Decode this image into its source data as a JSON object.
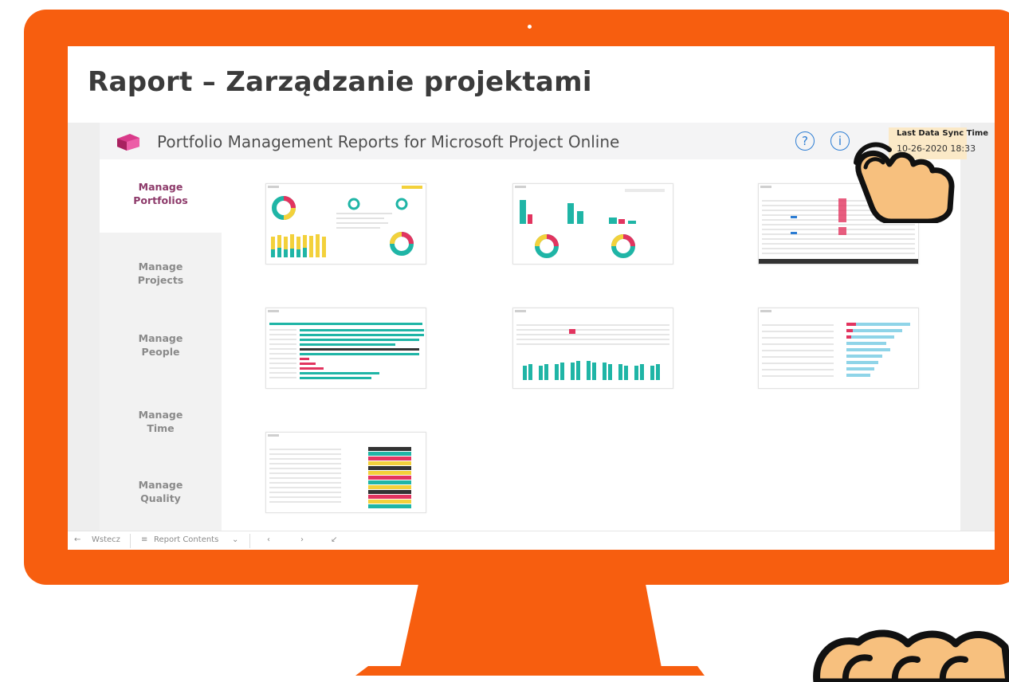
{
  "page_title": "Raport – Zarządzanie projektami",
  "report": {
    "app_title": "Portfolio Management Reports for Microsoft Project Online",
    "help_icon": "?",
    "info_icon": "i",
    "sync_label": "Last Data Sync Time",
    "sync_time": "10-26-2020 18:33"
  },
  "sidebar": {
    "items": [
      {
        "label": "Manage Portfolios",
        "active": true
      },
      {
        "label": "Manage Projects",
        "active": false
      },
      {
        "label": "Manage People",
        "active": false
      },
      {
        "label": "Manage Time",
        "active": false
      },
      {
        "label": "Manage Quality",
        "active": false
      }
    ]
  },
  "bottom_bar": {
    "back_label": "Wstecz",
    "contents_label": "Report Contents"
  },
  "colors": {
    "frame": "#f75e0f",
    "accent_teal": "#1fb5a6",
    "accent_pink": "#e2345f",
    "accent_yellow": "#f3d13b",
    "active_nav": "#8d3a6a",
    "icon_blue": "#2b7cd3"
  },
  "icons": {
    "logo": "project-online-logo-icon",
    "pointer": "pointing-hand-icon"
  }
}
